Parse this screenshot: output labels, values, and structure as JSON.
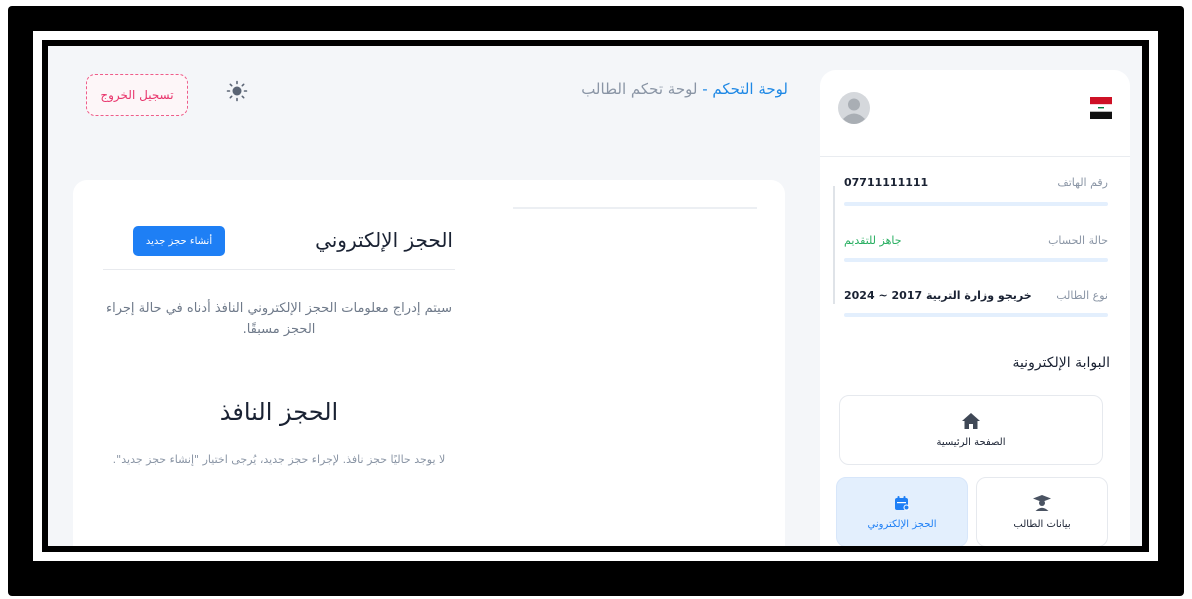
{
  "header": {
    "logout_label": "تسجيل الخروج",
    "title_main": "لوحة التحكم",
    "title_sep": " - ",
    "title_sub": "لوحة تحكم الطالب"
  },
  "booking": {
    "title": "الحجز الإلكتروني",
    "new_button": "أنشاء حجز جديد",
    "info": "سيتم إدراج معلومات الحجز الإلكتروني النافذ أدناه في حالة إجراء الحجز مسبقًا.",
    "active_title": "الحجز النافذ",
    "active_desc": "لا يوجد حاليًا حجز نافذ. لإجراء حجز جديد، يُرجى اختيار \"إنشاء حجز جديد\"."
  },
  "profile": {
    "phone_label": "رقم الهاتف",
    "phone_value": "07711111111",
    "status_label": "حالة الحساب",
    "status_value": "جاهز للتقديم",
    "type_label": "نوع الطالب",
    "type_value": "خريجو وزارة التربية 2017 ~ 2024"
  },
  "portal": {
    "title": "البوابة الإلكترونية",
    "nav": {
      "home": "الصفحة الرئيسية",
      "student_data": "بيانات الطالب",
      "booking": "الحجز الإلكتروني"
    }
  },
  "colors": {
    "accent": "#1e7ff5",
    "danger": "#e8336b",
    "success": "#27ae60"
  },
  "icons": [
    "sun-icon",
    "avatar-icon",
    "iraq-flag-icon",
    "home-icon",
    "student-icon",
    "calendar-icon"
  ]
}
